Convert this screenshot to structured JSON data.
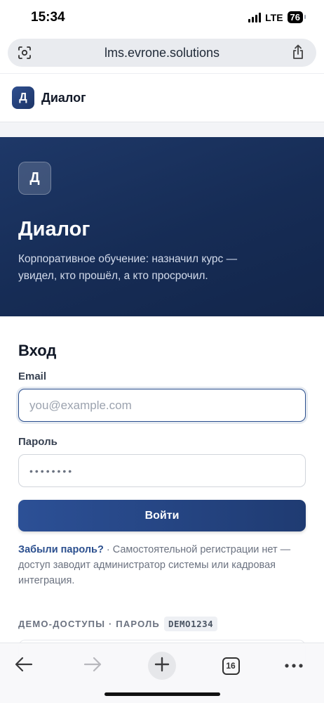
{
  "status_bar": {
    "time": "15:34",
    "network": "LTE",
    "battery": "76"
  },
  "browser": {
    "url": "lms.evrone.solutions",
    "tabs_count": "16"
  },
  "header": {
    "logo_letter": "Д",
    "brand": "Диалог"
  },
  "hero": {
    "logo_letter": "Д",
    "title": "Диалог",
    "tagline": "Корпоративное обучение: назначил курс — увидел, кто прошёл, а кто просрочил."
  },
  "login": {
    "title": "Вход",
    "email_label": "Email",
    "email_placeholder": "you@example.com",
    "password_label": "Пароль",
    "password_value": "••••••••",
    "submit_label": "Войти",
    "forgot_link": "Забыли пароль?",
    "help_text": " · Самостоятельной регистрации нет — доступ заводит администратор системы или кадровая интеграция."
  },
  "demo": {
    "heading": "ДЕМО-ДОСТУПЫ · ПАРОЛЬ",
    "password_code": "DEMO1234"
  },
  "colors": {
    "brand": "#1e3868",
    "accent": "#2b4f8e"
  },
  "icons": [
    "page-settings-icon",
    "share-icon",
    "back-arrow-icon",
    "forward-arrow-icon",
    "plus-icon",
    "tabs-icon",
    "more-icon"
  ]
}
